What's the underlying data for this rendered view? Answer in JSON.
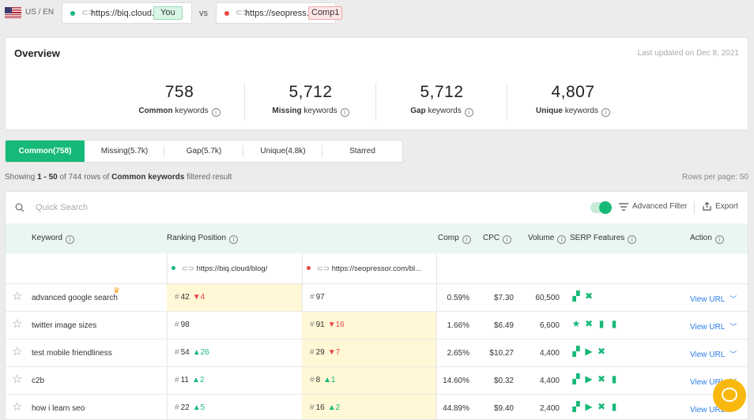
{
  "topbar": {
    "locale": "US / EN",
    "your_domain": {
      "url": "https://biq.cloud...",
      "tag": "You",
      "dot_color": "#17b978"
    },
    "vs": "vs",
    "comp_domain": {
      "url": "https://seopress...",
      "tag": "Comp1",
      "dot_color": "#e84545"
    }
  },
  "overview": {
    "title": "Overview",
    "updated": "Last updated on Dec 8, 2021",
    "stats": [
      {
        "value": "758",
        "bold": "Common",
        "rest": " keywords"
      },
      {
        "value": "5,712",
        "bold": "Missing",
        "rest": " keywords"
      },
      {
        "value": "5,712",
        "bold": "Gap",
        "rest": " keywords"
      },
      {
        "value": "4,807",
        "bold": "Unique",
        "rest": " keywords"
      }
    ]
  },
  "tabs": [
    "Common(758)",
    "Missing(5.7k)",
    "Gap(5.7k)",
    "Unique(4.8k)",
    "Starred"
  ],
  "summary": {
    "showing_pre": "Showing ",
    "range": "1 - 50",
    "of": " of 744 rows of ",
    "type": "Common keywords",
    "suffix": " filtered result",
    "rows_per_page": "Rows per page: 50"
  },
  "toolbar": {
    "search_placeholder": "Quick Search",
    "advanced_filter": "Advanced Filter",
    "export": "Export"
  },
  "table": {
    "headers": {
      "keyword": "Keyword",
      "ranking": "Ranking Position",
      "comp": "Comp",
      "cpc": "CPC",
      "volume": "Volume",
      "serp": "SERP Features",
      "action": "Action"
    },
    "sub": {
      "you_url": "https://biq.cloud/blog/",
      "comp_url": "https://seopressor.com/bl..."
    },
    "rows": [
      {
        "keyword": "advanced google search",
        "crown": true,
        "you": "42",
        "you_chg": "4",
        "you_dir": "down",
        "you_hl": true,
        "comp": "97",
        "comp_chg": "",
        "comp_dir": "",
        "comp_hl": false,
        "comp_pct": "0.59%",
        "cpc": "$7.30",
        "volume": "60,500",
        "serp": [
          "ad-icon",
          "shuffle-icon"
        ],
        "action": "View URL"
      },
      {
        "keyword": "twitter image sizes",
        "crown": false,
        "you": "98",
        "you_chg": "",
        "you_dir": "",
        "you_hl": false,
        "comp": "91",
        "comp_chg": "16",
        "comp_dir": "down",
        "comp_hl": true,
        "comp_pct": "1.66%",
        "cpc": "$6.49",
        "volume": "6,600",
        "serp": [
          "star-icon",
          "shuffle-icon",
          "carousel-icon",
          "carousel-icon"
        ],
        "action": "View URL"
      },
      {
        "keyword": "test mobile friendliness",
        "crown": false,
        "you": "54",
        "you_chg": "26",
        "you_dir": "up",
        "you_hl": false,
        "comp": "29",
        "comp_chg": "7",
        "comp_dir": "down",
        "comp_hl": true,
        "comp_pct": "2.65%",
        "cpc": "$10.27",
        "volume": "4,400",
        "serp": [
          "ad-icon",
          "video-icon",
          "shuffle-icon"
        ],
        "action": "View URL"
      },
      {
        "keyword": "c2b",
        "crown": false,
        "you": "11",
        "you_chg": "2",
        "you_dir": "up",
        "you_hl": false,
        "comp": "8",
        "comp_chg": "1",
        "comp_dir": "up",
        "comp_hl": true,
        "comp_pct": "14.60%",
        "cpc": "$0.32",
        "volume": "4,400",
        "serp": [
          "ad-icon",
          "video-icon",
          "shuffle-icon",
          "carousel-icon"
        ],
        "action": "View URL"
      },
      {
        "keyword": "how i learn seo",
        "crown": false,
        "you": "22",
        "you_chg": "5",
        "you_dir": "up",
        "you_hl": false,
        "comp": "16",
        "comp_chg": "2",
        "comp_dir": "up",
        "comp_hl": true,
        "comp_pct": "44.89%",
        "cpc": "$9.40",
        "volume": "2,400",
        "serp": [
          "ad-icon",
          "video-icon",
          "shuffle-icon",
          "carousel-icon"
        ],
        "action": "View URL"
      }
    ]
  },
  "colors": {
    "accent": "#17b978",
    "highlight": "#fff7d6",
    "link": "#2b7de9",
    "down": "#e84545",
    "chat": "#f9b80e"
  }
}
